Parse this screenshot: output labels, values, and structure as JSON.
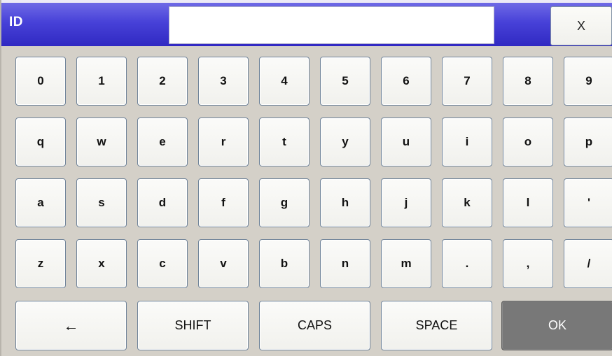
{
  "title_bar": {
    "label": "ID",
    "input_value": "",
    "close_label": "X",
    "accent_color": "#4741d8"
  },
  "keys": {
    "row0": [
      "0",
      "1",
      "2",
      "3",
      "4",
      "5",
      "6",
      "7",
      "8",
      "9"
    ],
    "row1": [
      "q",
      "w",
      "e",
      "r",
      "t",
      "y",
      "u",
      "i",
      "o",
      "p"
    ],
    "row2": [
      "a",
      "s",
      "d",
      "f",
      "g",
      "h",
      "j",
      "k",
      "l",
      "'"
    ],
    "row3": [
      "z",
      "x",
      "c",
      "v",
      "b",
      "n",
      "m",
      ".",
      ",",
      "/"
    ]
  },
  "bottom_row": {
    "backspace": "←",
    "shift": "SHIFT",
    "caps": "CAPS",
    "space": "SPACE",
    "ok": "OK"
  }
}
